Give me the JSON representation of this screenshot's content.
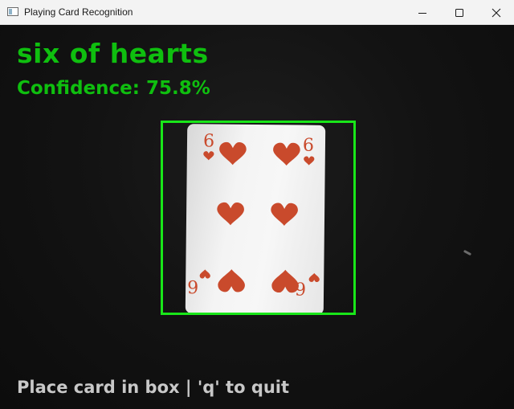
{
  "window": {
    "title": "Playing Card Recognition",
    "icon": "app-window-icon",
    "controls": [
      "minimize-icon",
      "maximize-icon",
      "close-icon"
    ]
  },
  "overlay": {
    "card_label": "six of hearts",
    "confidence_text": "Confidence: 75.8%",
    "instruction": "Place card in box | 'q' to quit"
  },
  "card": {
    "rank": "6",
    "suit": "hearts",
    "pips": 6
  },
  "colors": {
    "label_text": "#0fbf0f",
    "confidence_text": "#0fbf0f",
    "instruction_text": "#c8c8c8",
    "detection_box": "#19e619",
    "heart_red": "#c94a2c",
    "camera_background": "#111111"
  }
}
